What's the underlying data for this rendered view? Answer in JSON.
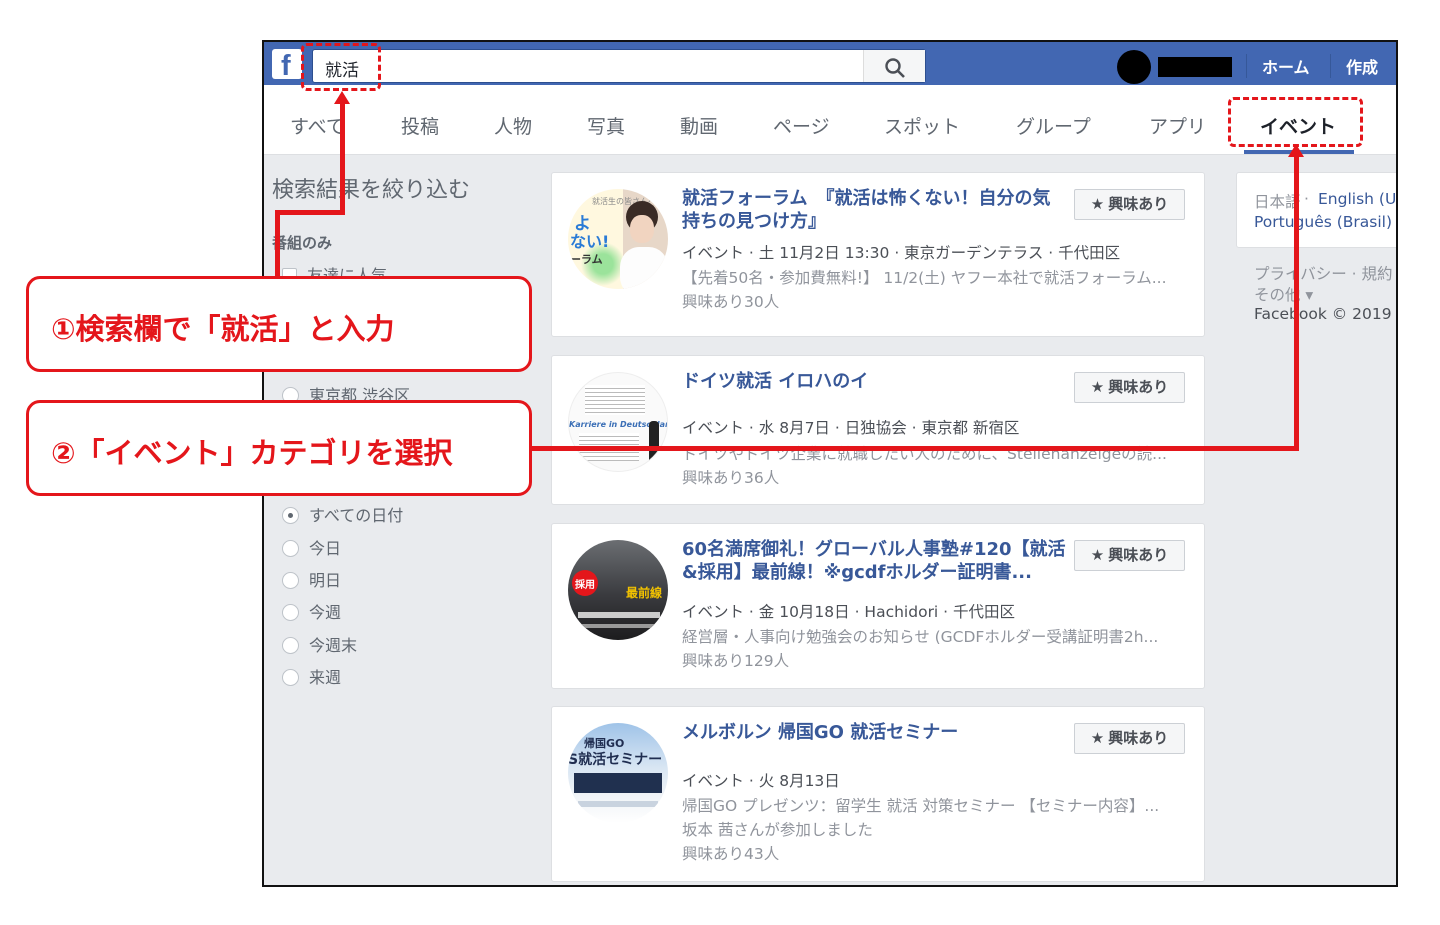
{
  "topbar": {
    "logo": "f",
    "search_value": "就活",
    "home": "ホーム",
    "create": "作成"
  },
  "tabs": [
    "すべて",
    "投稿",
    "人物",
    "写真",
    "動画",
    "ページ",
    "スポット",
    "グループ",
    "アプリ",
    "イベント"
  ],
  "filter": {
    "title": "検索結果を絞り込む",
    "group_label": "番組のみ",
    "friends_option": "友達に人気",
    "location_option": "東京都 渋谷区",
    "date_options": [
      "すべての日付",
      "今日",
      "明日",
      "今週",
      "今週末",
      "来週"
    ]
  },
  "events": [
    {
      "title": "就活フォーラム　『就活は怖くない！自分の気持ちの見つけ方』",
      "meta": "イベント · 土 11月2日 13:30 · 東京ガーデンテラス · 千代田区",
      "desc": "【先着50名・参加費無料!】 11/2(土) ヤフー本社で就活フォーラム...",
      "interested": "興味あり30人"
    },
    {
      "title": "ドイツ就活 イロハのイ",
      "meta": "イベント · 水 8月7日 · 日独協会 · 東京都 新宿区",
      "desc": "ドイツやドイツ企業に就職したい人のために、Stellenanzeigeの読...",
      "interested": "興味あり36人"
    },
    {
      "title": "60名満席御礼！グローバル人事塾#120【就活&採用】最前線！※gcdfホルダー証明書...",
      "meta": "イベント · 金 10月18日 · Hachidori · 千代田区",
      "desc": "経営層・人事向け勉強会のお知らせ (GCDFホルダー受講証明書2h...",
      "interested": "興味あり129人"
    },
    {
      "title": "メルボルン 帰国GO 就活セミナー",
      "meta": "イベント · 火 8月13日",
      "desc": "帰国GO プレゼンツ：留学生 就活 対策セミナー 【セミナー内容】...",
      "extra": "坂本 茜さんが参加しました",
      "interested": "興味あり43人"
    }
  ],
  "interested_button": "興味あり",
  "thumb_text": {
    "t1a": "よ",
    "t1b": "ない!",
    "t1c": "ーラム",
    "t1d": "就活生の皆さんへ",
    "t2a": "Karriere in Deutschland:",
    "t3a": "採用",
    "t3b": "最前線",
    "t4a": "帰国GO",
    "t4b": "S就活セミナー"
  },
  "right": {
    "lang1": "日本語",
    "lang2": "English (US)",
    "lang3": "Português (Brasil)",
    "privacy": "プライバシー · 規約",
    "other": "その他 ▾",
    "copyright": "Facebook © 2019"
  },
  "callouts": {
    "step1": "①検索欄で「就活」と入力",
    "step2": "②「イベント」カテゴリを選択"
  },
  "colors": {
    "fb_blue": "#4267b2",
    "annotation_red": "#e4161b",
    "link": "#385898"
  }
}
